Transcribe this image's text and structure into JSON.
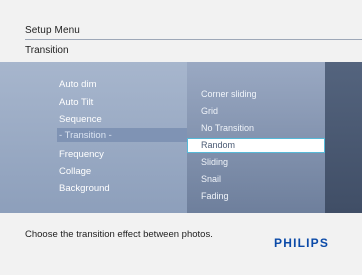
{
  "header": {
    "title": "Setup Menu",
    "subtitle": "Transition"
  },
  "menu": {
    "items": [
      {
        "label": "Auto dim"
      },
      {
        "label": "Auto Tilt"
      },
      {
        "label": "Sequence"
      },
      {
        "label": "- Transition -"
      },
      {
        "label": "Frequency"
      },
      {
        "label": "Collage"
      },
      {
        "label": "Background"
      }
    ]
  },
  "options": {
    "items": [
      {
        "label": "Corner sliding"
      },
      {
        "label": "Grid"
      },
      {
        "label": "No Transition"
      },
      {
        "label": "Random"
      },
      {
        "label": "Sliding"
      },
      {
        "label": "Snail"
      },
      {
        "label": "Fading"
      }
    ]
  },
  "footer": {
    "hint": "Choose the transition effect between photos.",
    "brand": "PHILIPS"
  },
  "colors": {
    "accent": "#56b9d8",
    "brand": "#0b4aa8"
  }
}
